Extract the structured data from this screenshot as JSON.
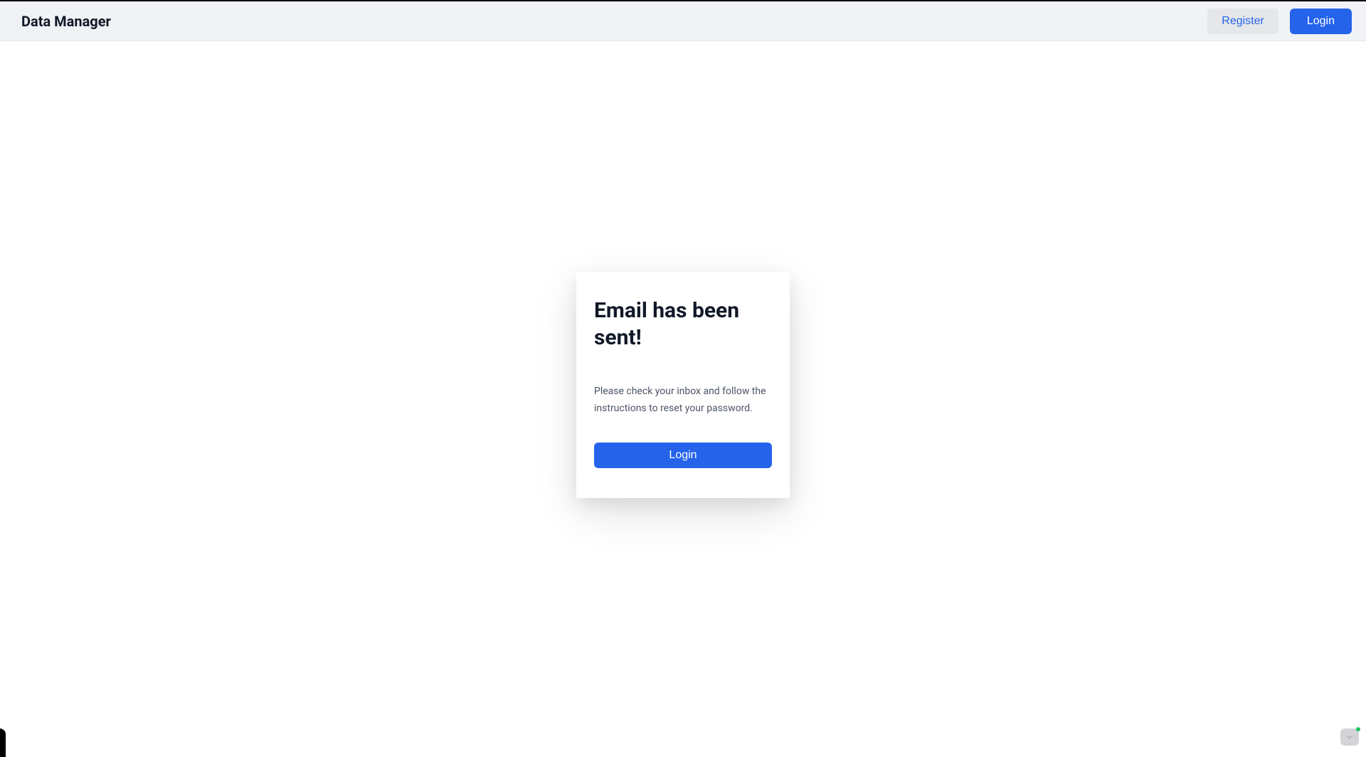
{
  "header": {
    "app_title": "Data Manager",
    "register_label": "Register",
    "login_label": "Login"
  },
  "card": {
    "title": "Email has been sent!",
    "message": "Please check your inbox and follow the instructions to reset your password.",
    "login_button": "Login"
  }
}
